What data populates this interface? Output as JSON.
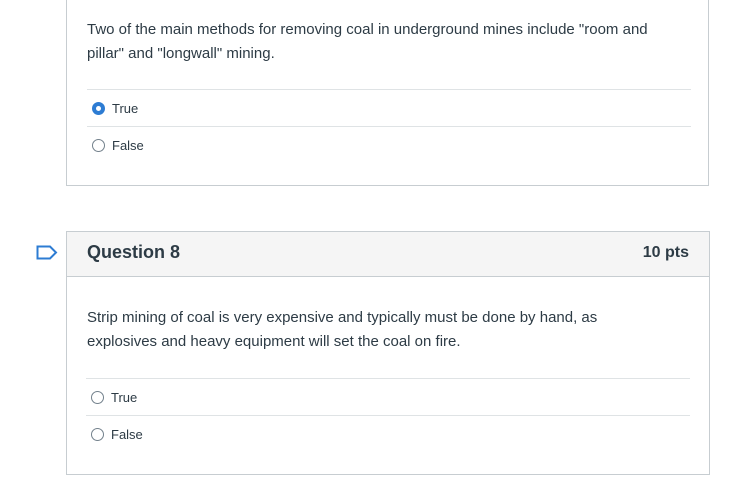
{
  "question7": {
    "text": "Two of the main methods for removing coal in underground mines include \"room and pillar\" and \"longwall\" mining.",
    "answers": [
      {
        "label": "True",
        "selected": true
      },
      {
        "label": "False",
        "selected": false
      }
    ]
  },
  "question8": {
    "title": "Question 8",
    "points": "10 pts",
    "text": "Strip mining of coal is very expensive and typically must be done by hand, as explosives and heavy equipment will set the coal on fire.",
    "answers": [
      {
        "label": "True",
        "selected": false
      },
      {
        "label": "False",
        "selected": false
      }
    ]
  },
  "icons": {
    "flag": "flag-question-icon"
  },
  "colors": {
    "accent": "#2d7cd3",
    "text": "#2d3b45",
    "border": "#c7cdd1",
    "header_bg": "#f5f5f5"
  }
}
